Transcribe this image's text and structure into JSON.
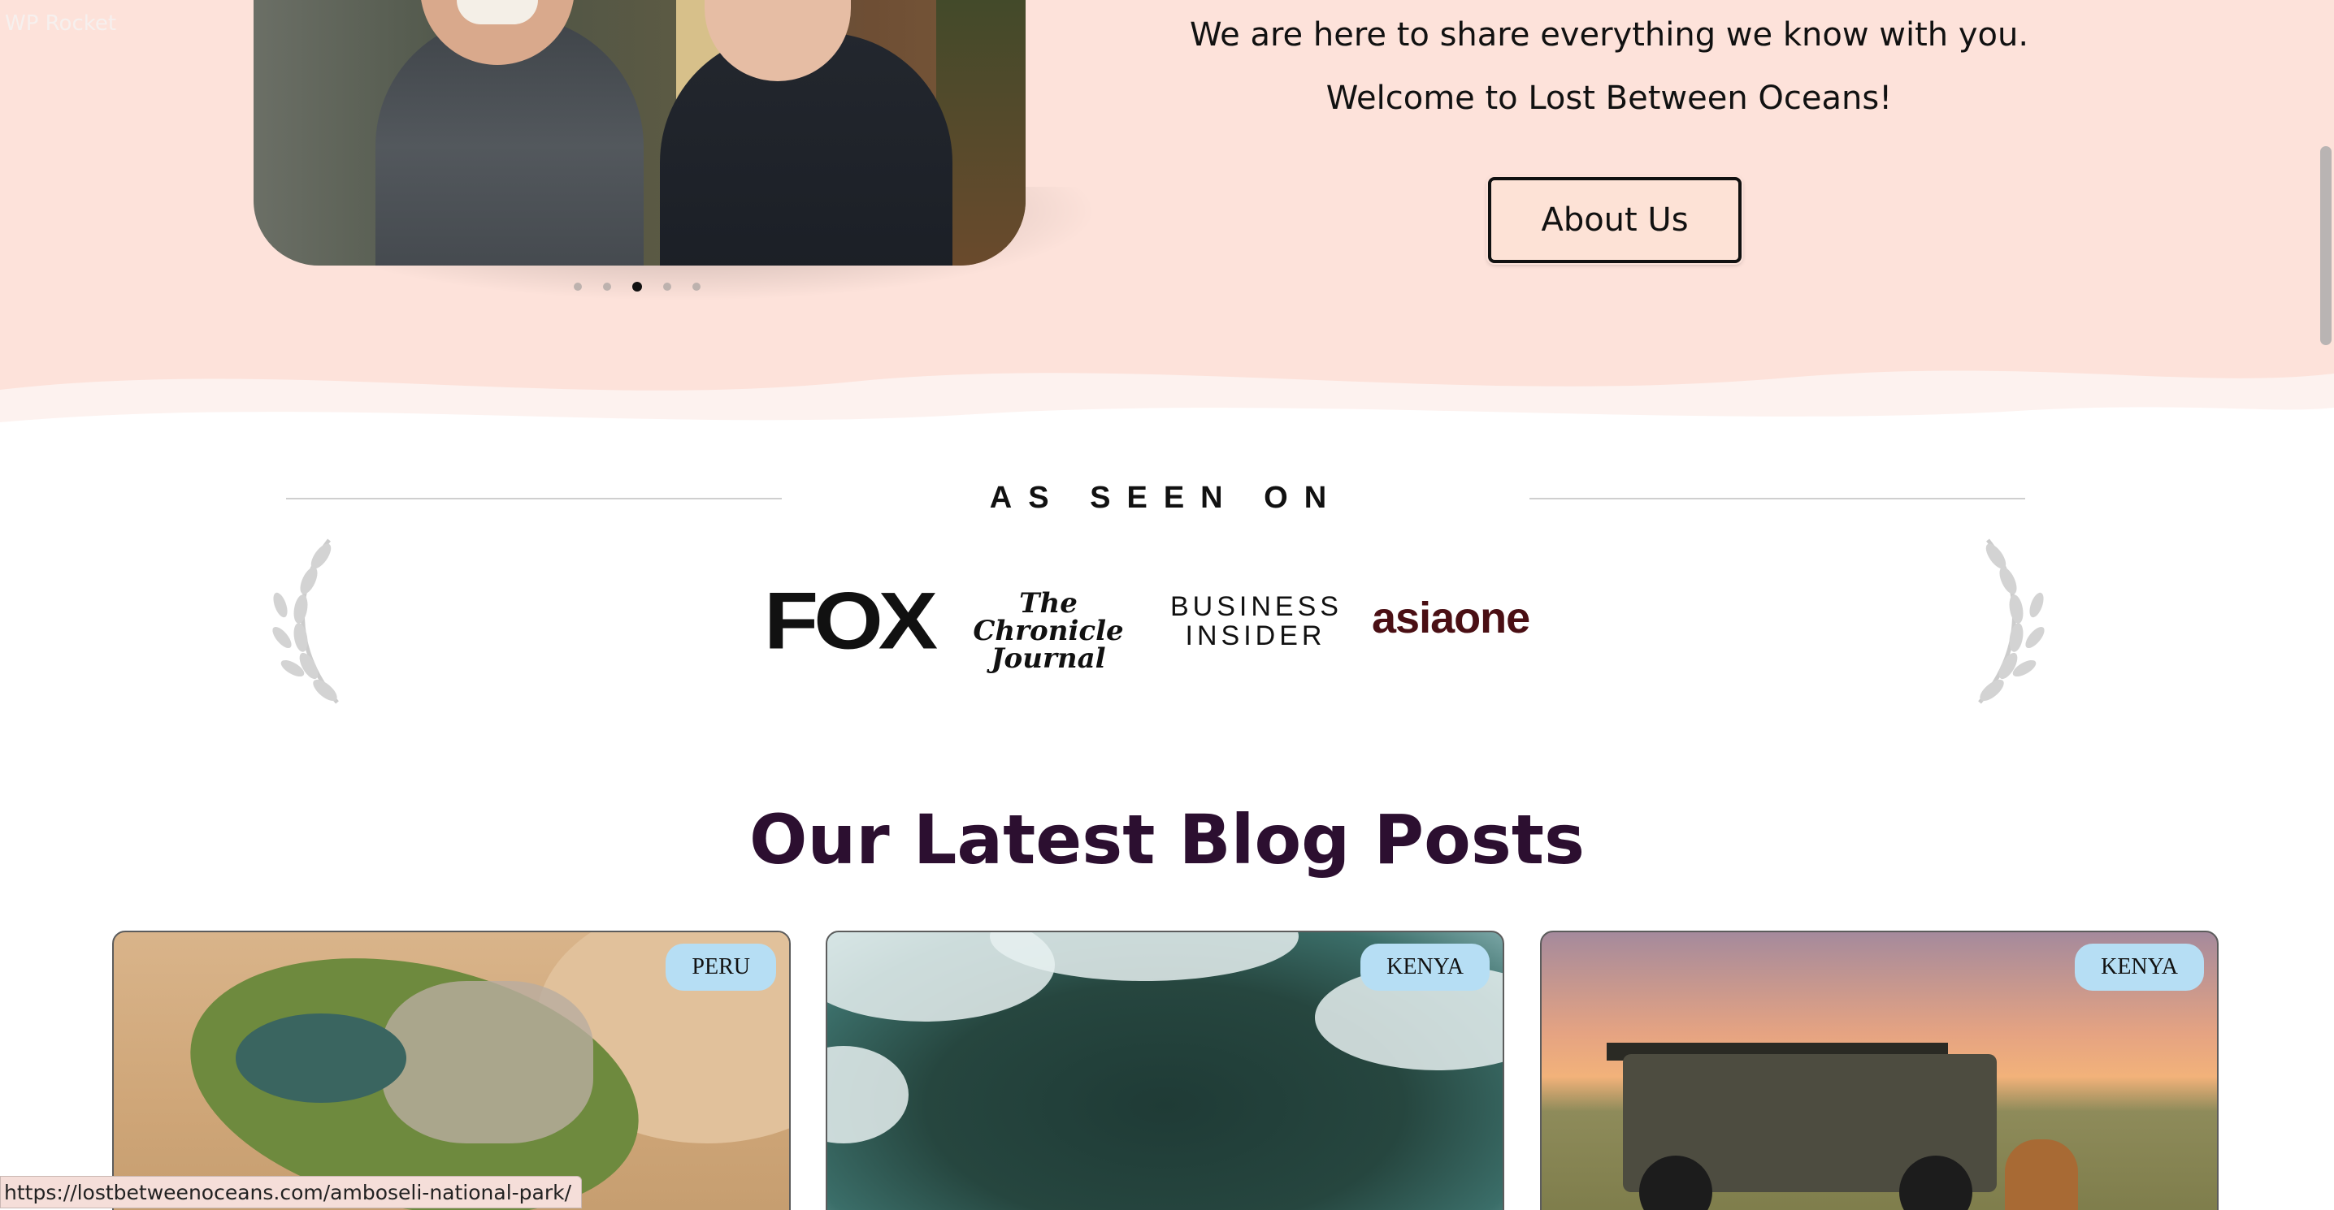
{
  "overlay": {
    "label": "WP Rocket"
  },
  "hero": {
    "intro_line1": "We are here to share everything we know with you.",
    "intro_line2": "Welcome to Lost Between Oceans!",
    "about_button": "About Us",
    "slider": {
      "slides": 5,
      "active_index": 2
    }
  },
  "seen_on": {
    "title": "AS SEEN ON",
    "logos": {
      "fox": "FOX",
      "chronicle_line1": "The Chronicle",
      "chronicle_line2": "Journal",
      "bi_line1": "BUSINESS",
      "bi_line2": "INSIDER",
      "asiaone": "asiaone"
    }
  },
  "blog": {
    "title": "Our Latest Blog Posts",
    "cards": [
      {
        "tag": "PERU"
      },
      {
        "tag": "KENYA"
      },
      {
        "tag": "KENYA"
      }
    ]
  },
  "status_bar": {
    "url": "https://lostbetweenoceans.com/amboseli-national-park/"
  },
  "colors": {
    "hero_bg": "#fde2da",
    "tag_bg": "#b6def4",
    "heading": "#2c0f30",
    "asiaone": "#4a0f14"
  }
}
